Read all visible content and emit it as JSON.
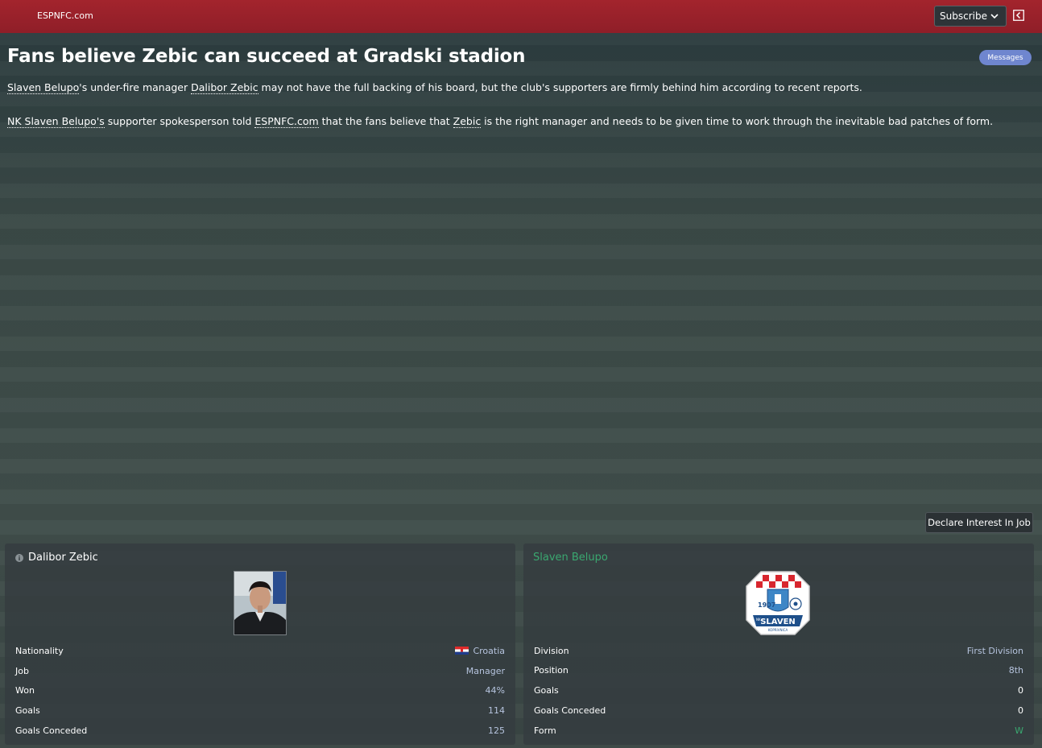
{
  "header": {
    "source": "ESPNFC.com",
    "subscribe_label": "Subscribe"
  },
  "article": {
    "headline": "Fans believe Zebic can succeed at Gradski stadion",
    "messages_label": "Messages",
    "p1": {
      "club": "Slaven Belupo",
      "t1": "'s under-fire manager ",
      "manager": "Dalibor Zebic",
      "t2": " may not have the full backing of his board, but the club's supporters are firmly behind him according to recent reports."
    },
    "p2": {
      "club": "NK Slaven Belupo's",
      "t1": " supporter spokesperson told ",
      "source": "ESPNFC.com",
      "t2": " that the fans believe that ",
      "manager": "Zebic",
      "t3": " is the right manager and needs to be given time to work through the inevitable bad patches of form."
    }
  },
  "actions": {
    "declare_interest": "Declare Interest In Job"
  },
  "manager_card": {
    "name": "Dalibor Zebic",
    "rows": [
      {
        "label": "Nationality",
        "value": "Croatia"
      },
      {
        "label": "Job",
        "value": "Manager"
      },
      {
        "label": "Won",
        "value": "44%"
      },
      {
        "label": "Goals",
        "value": "114"
      },
      {
        "label": "Goals Conceded",
        "value": "125"
      }
    ]
  },
  "club_card": {
    "name": "Slaven Belupo",
    "crest_text": {
      "year": "1907",
      "name": "SLAVEN",
      "nk": "NK",
      "city": "KOPRIVNICA"
    },
    "rows": [
      {
        "label": "Division",
        "value": "First Division"
      },
      {
        "label": "Position",
        "value": "8th"
      },
      {
        "label": "Goals",
        "value": "0"
      },
      {
        "label": "Goals Conceded",
        "value": "0"
      },
      {
        "label": "Form",
        "value": "W"
      }
    ]
  },
  "colors": {
    "header_red": "#9a2029",
    "messages_blue": "#6f86cf",
    "club_green": "#3aa870",
    "value_blue": "#b6c4de"
  }
}
